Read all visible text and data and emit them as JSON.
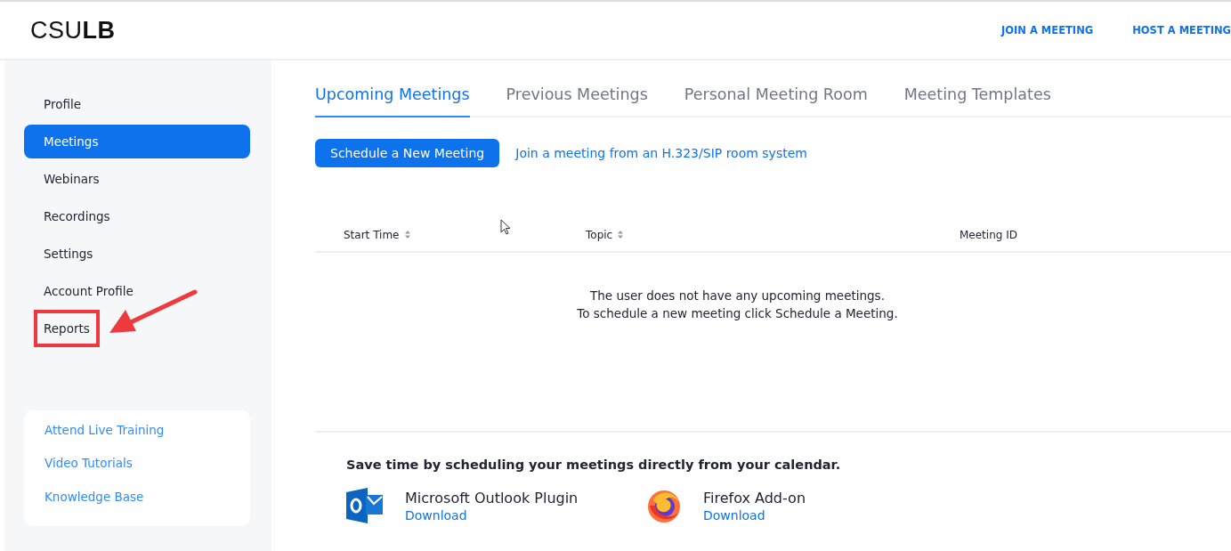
{
  "header": {
    "logo_light": "CSU",
    "logo_bold": "LB",
    "links": [
      "JOIN A MEETING",
      "HOST A MEETING"
    ]
  },
  "sidebar": {
    "items": [
      {
        "label": "Profile",
        "selected": false,
        "annotated": false
      },
      {
        "label": "Meetings",
        "selected": true,
        "annotated": false
      },
      {
        "label": "Webinars",
        "selected": false,
        "annotated": false
      },
      {
        "label": "Recordings",
        "selected": false,
        "annotated": false
      },
      {
        "label": "Settings",
        "selected": false,
        "annotated": false
      },
      {
        "label": "Account Profile",
        "selected": false,
        "annotated": false
      },
      {
        "label": "Reports",
        "selected": false,
        "annotated": true
      }
    ],
    "help_links": [
      "Attend Live Training",
      "Video Tutorials",
      "Knowledge Base"
    ]
  },
  "tabs": [
    {
      "label": "Upcoming Meetings",
      "selected": true
    },
    {
      "label": "Previous Meetings",
      "selected": false
    },
    {
      "label": "Personal Meeting Room",
      "selected": false
    },
    {
      "label": "Meeting Templates",
      "selected": false
    }
  ],
  "schedule_button": "Schedule a New Meeting",
  "sip_link": "Join a meeting from an H.323/SIP room system",
  "table": {
    "columns": [
      {
        "label": "Start Time",
        "sortable": true
      },
      {
        "label": "Topic",
        "sortable": true
      },
      {
        "label": "Meeting ID",
        "sortable": false
      }
    ],
    "empty_lines": [
      "The user does not have any upcoming meetings.",
      "To schedule a new meeting click Schedule a Meeting."
    ]
  },
  "calendar": {
    "title": "Save time by scheduling your meetings directly from your calendar.",
    "plugins": [
      {
        "kind": "outlook",
        "name": "Microsoft Outlook Plugin",
        "link": "Download"
      },
      {
        "kind": "firefox",
        "name": "Firefox Add-on",
        "link": "Download"
      }
    ]
  }
}
